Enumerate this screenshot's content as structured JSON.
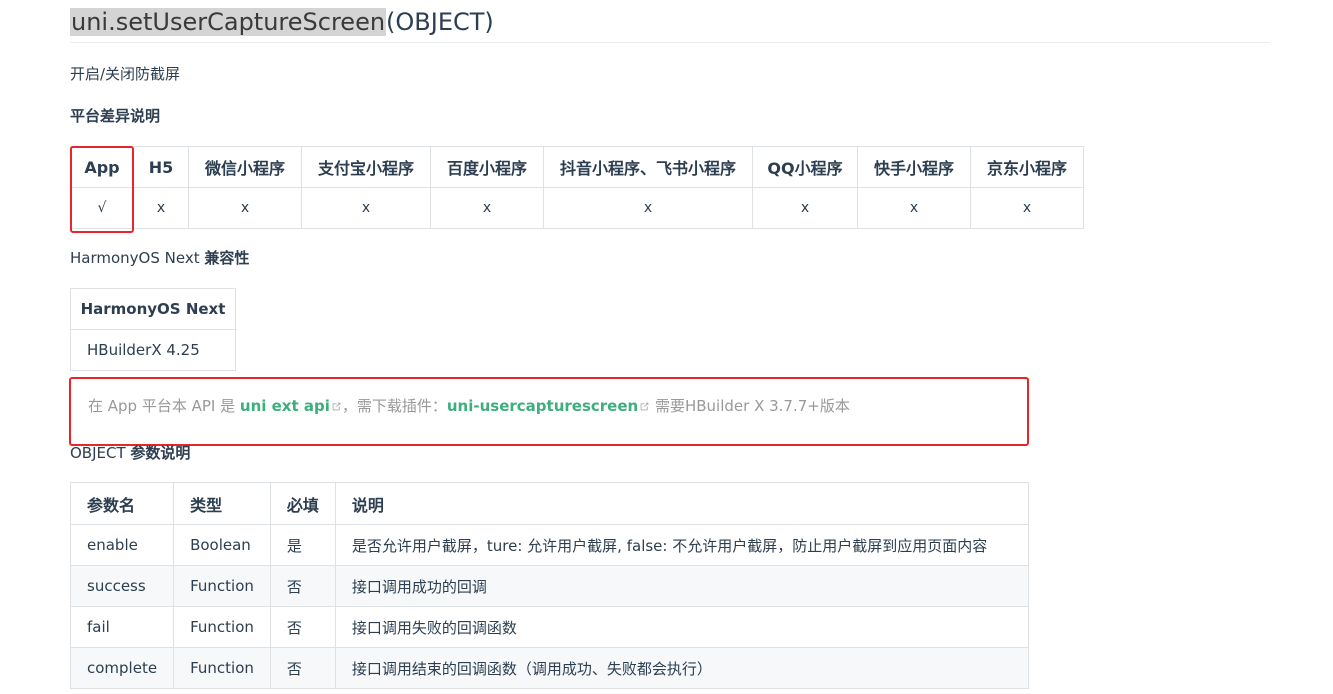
{
  "title": {
    "code": "uni.setUserCaptureScreen",
    "suffix": "(OBJECT)"
  },
  "description": "开启/关闭防截屏",
  "platform_heading": "平台差异说明",
  "platform_table": {
    "headers": [
      "App",
      "H5",
      "微信小程序",
      "支付宝小程序",
      "百度小程序",
      "抖音小程序、飞书小程序",
      "QQ小程序",
      "快手小程序",
      "京东小程序"
    ],
    "values": [
      "√",
      "x",
      "x",
      "x",
      "x",
      "x",
      "x",
      "x",
      "x"
    ]
  },
  "harmony": {
    "heading_prefix": "HarmonyOS Next",
    "heading_suffix": "兼容性",
    "header": "HarmonyOS Next",
    "value": "HBuilderX 4.25"
  },
  "tip": {
    "part1": "在 App 平台本 API 是",
    "link1": "uni ext api",
    "part2": "，需下载插件：",
    "link2": "uni-usercapturescreen",
    "part3": "需要HBuilder X 3.7.7+版本"
  },
  "object_heading": {
    "prefix": "OBJECT",
    "suffix": "参数说明"
  },
  "params_table": {
    "headers": [
      "参数名",
      "类型",
      "必填",
      "说明"
    ],
    "rows": [
      [
        "enable",
        "Boolean",
        "是",
        "是否允许用户截屏，ture: 允许用户截屏, false: 不允许用户截屏，防止用户截屏到应用页面内容"
      ],
      [
        "success",
        "Function",
        "否",
        "接口调用成功的回调"
      ],
      [
        "fail",
        "Function",
        "否",
        "接口调用失败的回调函数"
      ],
      [
        "complete",
        "Function",
        "否",
        "接口调用结束的回调函数（调用成功、失败都会执行）"
      ]
    ]
  },
  "colors": {
    "link": "#3eaf7c",
    "highlight": "#e8262a",
    "border": "#dfe2e5",
    "muted": "#999999"
  },
  "icons": {
    "external_link": "external-link-icon"
  }
}
